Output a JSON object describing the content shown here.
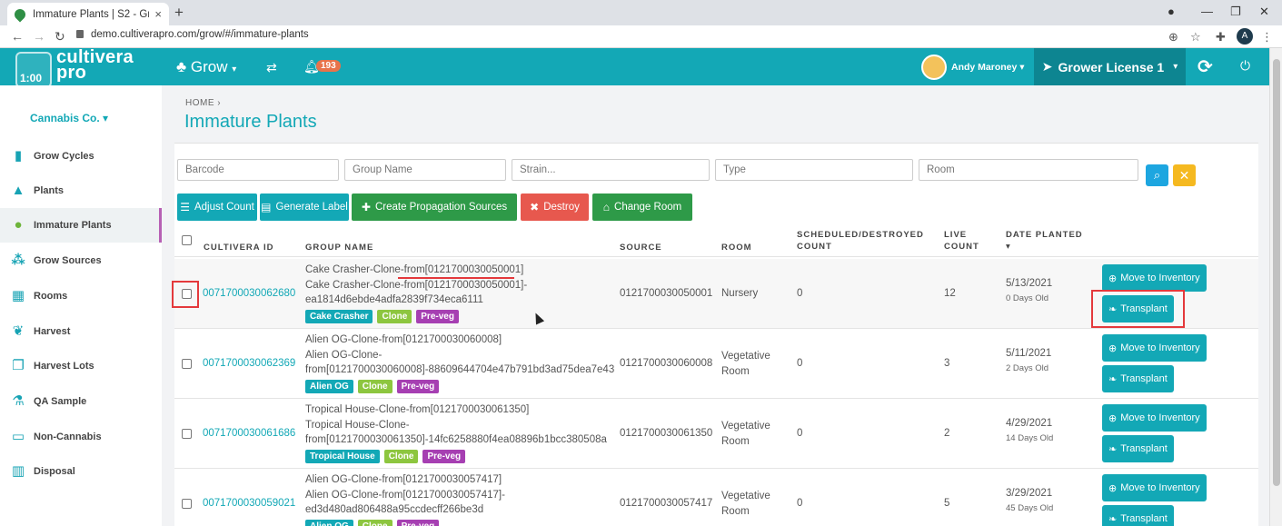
{
  "browser": {
    "tab_title": "Immature Plants | S2 - Grow",
    "tab_close": "×",
    "new_tab": "+",
    "url": "demo.cultiverapro.com/grow/#/immature-plants",
    "profile_initial": "A"
  },
  "header": {
    "logo_top": "cultivera",
    "logo_bottom": "pro",
    "logo_overlay": "1:00",
    "grow_menu": "Grow",
    "notification_count": "193",
    "user_name": "Andy Maroney",
    "license": "Grower License 1",
    "brand_color": "#13a8b6"
  },
  "sidebar": {
    "company": "Cannabis Co.",
    "items": [
      {
        "label": "Grow Cycles",
        "icon": "bar-chart-icon",
        "glyph": "▮"
      },
      {
        "label": "Plants",
        "icon": "tree-icon",
        "glyph": "▲"
      },
      {
        "label": "Immature Plants",
        "icon": "sapling-icon",
        "glyph": "●"
      },
      {
        "label": "Grow Sources",
        "icon": "cluster-icon",
        "glyph": "⁂"
      },
      {
        "label": "Rooms",
        "icon": "grid-icon",
        "glyph": "▦"
      },
      {
        "label": "Harvest",
        "icon": "harvest-icon",
        "glyph": "❦"
      },
      {
        "label": "Harvest Lots",
        "icon": "stack-icon",
        "glyph": "❐"
      },
      {
        "label": "QA Sample",
        "icon": "flask-icon",
        "glyph": "⚗"
      },
      {
        "label": "Non-Cannabis",
        "icon": "box-icon",
        "glyph": "▭"
      },
      {
        "label": "Disposal",
        "icon": "trash-icon",
        "glyph": "▥"
      }
    ]
  },
  "main": {
    "breadcrumb": "HOME  ›",
    "title": "Immature Plants",
    "filters": {
      "barcode": "Barcode",
      "group_name": "Group Name",
      "strain": "Strain...",
      "type": "Type",
      "room": "Room"
    },
    "actions": {
      "adjust_count": "Adjust Count",
      "generate_label": "Generate Label",
      "create_propagation": "Create Propagation Sources",
      "destroy": "Destroy",
      "change_room": "Change Room"
    },
    "columns": {
      "id": "CULTIVERA ID",
      "group": "GROUP NAME",
      "source": "SOURCE",
      "room": "ROOM",
      "scheduled": "SCHEDULED/DESTROYED COUNT",
      "live": "LIVE COUNT",
      "date": "DATE PLANTED"
    },
    "row_buttons": {
      "move": "Move to Inventory",
      "transplant": "Transplant"
    },
    "rows": [
      {
        "id": "0071700030062680",
        "name1": "Cake Crasher-Clone-from[0121700030050001]",
        "name2": "Cake Crasher-Clone-from[0121700030050001]-",
        "name3": "ea1814d6ebde4adfa2839f734eca6111",
        "tags": [
          "Cake Crasher",
          "Clone",
          "Pre-veg"
        ],
        "source": "0121700030050001",
        "room1": "Nursery",
        "room2": "",
        "scheduled": "0",
        "live": "12",
        "date": "5/13/2021",
        "age": "0 Days Old"
      },
      {
        "id": "0071700030062369",
        "name1": "Alien OG-Clone-from[0121700030060008]",
        "name2": "Alien OG-Clone-",
        "name3": "from[0121700030060008]-88609644704e47b791bd3ad75dea7e43",
        "tags": [
          "Alien OG",
          "Clone",
          "Pre-veg"
        ],
        "source": "0121700030060008",
        "room1": "Vegetative",
        "room2": "Room",
        "scheduled": "0",
        "live": "3",
        "date": "5/11/2021",
        "age": "2 Days Old"
      },
      {
        "id": "0071700030061686",
        "name1": "Tropical House-Clone-from[0121700030061350]",
        "name2": "Tropical House-Clone-",
        "name3": "from[0121700030061350]-14fc6258880f4ea08896b1bcc380508a",
        "tags": [
          "Tropical House",
          "Clone",
          "Pre-veg"
        ],
        "source": "0121700030061350",
        "room1": "Vegetative",
        "room2": "Room",
        "scheduled": "0",
        "live": "2",
        "date": "4/29/2021",
        "age": "14 Days Old"
      },
      {
        "id": "0071700030059021",
        "name1": "Alien OG-Clone-from[0121700030057417]",
        "name2": "Alien OG-Clone-from[0121700030057417]-",
        "name3": "ed3d480ad806488a95ccdecff266be3d",
        "tags": [
          "Alien OG",
          "Clone",
          "Pre-veg"
        ],
        "source": "0121700030057417",
        "room1": "Vegetative",
        "room2": "Room",
        "scheduled": "0",
        "live": "5",
        "date": "3/29/2021",
        "age": "45 Days Old"
      }
    ]
  }
}
